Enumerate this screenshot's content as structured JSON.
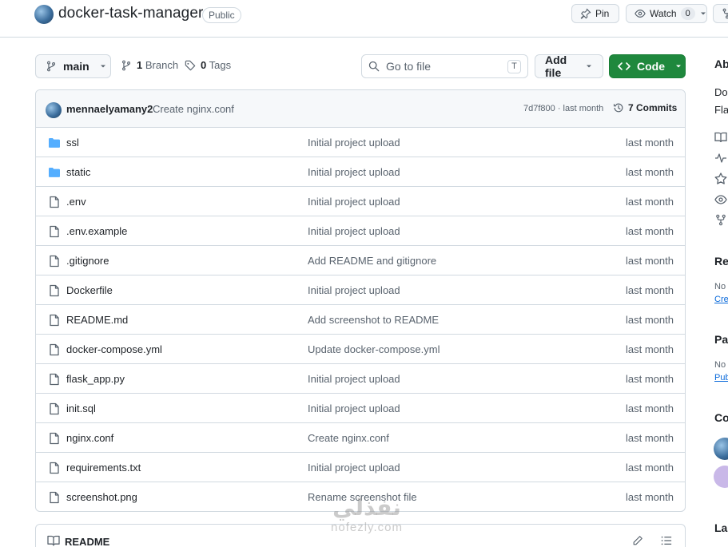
{
  "repo": {
    "name": "docker-task-manager",
    "visibility": "Public"
  },
  "header": {
    "pin_label": "Pin",
    "watch_label": "Watch",
    "watch_count": "0"
  },
  "toolbar": {
    "branch": "main",
    "branch_count": "1",
    "branch_label": "Branch",
    "tag_count": "0",
    "tag_label": "Tags",
    "search_placeholder": "Go to file",
    "search_shortcut": "T",
    "add_file_label": "Add file",
    "code_label": "Code"
  },
  "latest_commit": {
    "author": "mennaelyamany2",
    "message": "Create nginx.conf",
    "sha_time": "7d7f800 · last month",
    "commits_label": "7 Commits"
  },
  "files": [
    {
      "name": "ssl",
      "type": "folder",
      "commit": "Initial project upload",
      "date": "last month"
    },
    {
      "name": "static",
      "type": "folder",
      "commit": "Initial project upload",
      "date": "last month"
    },
    {
      "name": ".env",
      "type": "file",
      "commit": "Initial project upload",
      "date": "last month"
    },
    {
      "name": ".env.example",
      "type": "file",
      "commit": "Initial project upload",
      "date": "last month"
    },
    {
      "name": ".gitignore",
      "type": "file",
      "commit": "Add README and gitignore",
      "date": "last month"
    },
    {
      "name": "Dockerfile",
      "type": "file",
      "commit": "Initial project upload",
      "date": "last month"
    },
    {
      "name": "README.md",
      "type": "file",
      "commit": "Add screenshot to README",
      "date": "last month"
    },
    {
      "name": "docker-compose.yml",
      "type": "file",
      "commit": "Update docker-compose.yml",
      "date": "last month"
    },
    {
      "name": "flask_app.py",
      "type": "file",
      "commit": "Initial project upload",
      "date": "last month"
    },
    {
      "name": "init.sql",
      "type": "file",
      "commit": "Initial project upload",
      "date": "last month"
    },
    {
      "name": "nginx.conf",
      "type": "file",
      "commit": "Create nginx.conf",
      "date": "last month"
    },
    {
      "name": "requirements.txt",
      "type": "file",
      "commit": "Initial project upload",
      "date": "last month"
    },
    {
      "name": "screenshot.png",
      "type": "file",
      "commit": "Rename screenshot file",
      "date": "last month"
    }
  ],
  "readme": {
    "label": "README"
  },
  "sidebar": {
    "about_heading": "Ab",
    "about_line1": "Do",
    "about_line2": "Fla",
    "releases_heading": "Re",
    "releases_no": "No",
    "releases_link": "Cre",
    "packages_heading": "Pa",
    "packages_no": "No",
    "packages_link": "Pub",
    "contributors_heading": "Co",
    "languages_heading": "Lar"
  },
  "watermark": {
    "arabic": "نفذلي",
    "latin": "nofezly.com"
  },
  "colors": {
    "code_button": "#1f883d",
    "folder_icon": "#54aeff",
    "border": "#d1d9e0",
    "muted_text": "#59636e"
  }
}
